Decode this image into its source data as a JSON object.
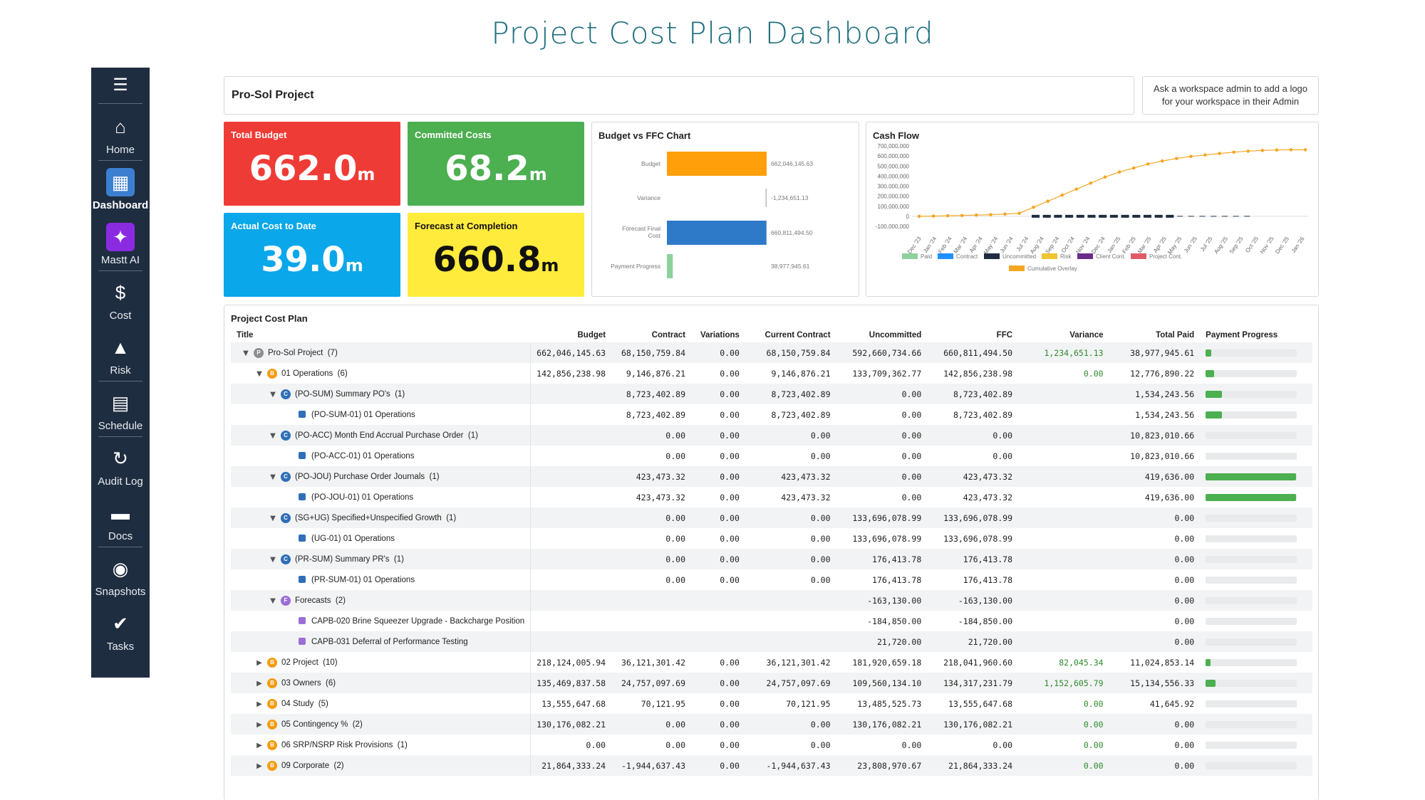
{
  "page_title": "Project Cost Plan Dashboard",
  "sidebar": {
    "items": [
      {
        "name": "home",
        "label": "Home",
        "icon": "home-icon",
        "glyph": "⌂",
        "active": false
      },
      {
        "name": "dashboard",
        "label": "Dashboard",
        "icon": "dashboard-icon",
        "glyph": "▦",
        "active": true
      },
      {
        "name": "mastt-ai",
        "label": "Mastt AI",
        "icon": "sparkle-icon",
        "glyph": "✦",
        "active": false
      },
      {
        "name": "cost",
        "label": "Cost",
        "icon": "dollar-icon",
        "glyph": "$",
        "active": false
      },
      {
        "name": "risk",
        "label": "Risk",
        "icon": "warning-icon",
        "glyph": "▲",
        "active": false
      },
      {
        "name": "schedule",
        "label": "Schedule",
        "icon": "schedule-icon",
        "glyph": "▤",
        "active": false
      },
      {
        "name": "audit-log",
        "label": "Audit Log",
        "icon": "history-icon",
        "glyph": "↻",
        "active": false
      },
      {
        "name": "docs",
        "label": "Docs",
        "icon": "folder-icon",
        "glyph": "▬",
        "active": false
      },
      {
        "name": "snapshots",
        "label": "Snapshots",
        "icon": "camera-icon",
        "glyph": "◉",
        "active": false
      },
      {
        "name": "tasks",
        "label": "Tasks",
        "icon": "check-icon",
        "glyph": "✔",
        "active": false
      }
    ]
  },
  "header": {
    "project_name": "Pro-Sol Project",
    "logo_prompt": "Ask a workspace admin to add a logo for your workspace in their Admin"
  },
  "kpis": {
    "total_budget": {
      "title": "Total Budget",
      "value": "662.0",
      "unit": "m"
    },
    "committed_costs": {
      "title": "Committed Costs",
      "value": "68.2",
      "unit": "m"
    },
    "actual_cost": {
      "title": "Actual Cost to Date",
      "value": "39.0",
      "unit": "m"
    },
    "forecast": {
      "title": "Forecast at Completion",
      "value": "660.8",
      "unit": "m"
    }
  },
  "chart_data": [
    {
      "type": "bar",
      "title": "Budget vs FFC Chart",
      "orientation": "horizontal",
      "categories": [
        "Budget",
        "Variance",
        "Forecast Final Cost",
        "Payment Progress"
      ],
      "values": [
        662046145.63,
        -1234651.13,
        660811494.5,
        38977945.61
      ],
      "value_labels": [
        "662,046,145.63",
        "-1,234,651.13",
        "660,811,494.50",
        "38,977,945.61"
      ],
      "colors": [
        "#ff9f0a",
        "#bbbbbb",
        "#2f7ac8",
        "#8fd19e"
      ]
    },
    {
      "type": "line",
      "title": "Cash Flow",
      "x": [
        "Dec '23",
        "Jan '24",
        "Feb '24",
        "Mar '24",
        "Apr '24",
        "May '24",
        "Jun '24",
        "Jul '24",
        "Aug '24",
        "Sep '24",
        "Oct '24",
        "Nov '24",
        "Dec '24",
        "Jan '25",
        "Feb '25",
        "Mar '25",
        "Apr '25",
        "May '25",
        "Jun '25",
        "Jul '25",
        "Aug '25",
        "Sep '25",
        "Oct '25",
        "Nov '25",
        "Dec '25",
        "Jan '26"
      ],
      "yticks": [
        "700,000,000",
        "600,000,000",
        "500,000,000",
        "400,000,000",
        "300,000,000",
        "200,000,000",
        "100,000,000",
        "0",
        "-100,000,000"
      ],
      "ylim": [
        -100000000,
        700000000
      ],
      "series": [
        {
          "name": "Cumulative Overlay",
          "color": "#f5a623",
          "values": [
            0,
            2000000,
            5000000,
            8000000,
            12000000,
            16000000,
            22000000,
            30000000,
            90000000,
            150000000,
            210000000,
            270000000,
            330000000,
            390000000,
            440000000,
            480000000,
            520000000,
            550000000,
            575000000,
            595000000,
            610000000,
            625000000,
            638000000,
            648000000,
            655000000,
            660000000,
            662000000,
            662000000
          ]
        },
        {
          "name": "Uncommitted",
          "color": "#1f2d40",
          "type": "bar",
          "values": [
            0,
            0,
            0,
            0,
            0,
            0,
            0,
            0,
            0,
            0,
            0,
            0,
            0,
            0,
            0,
            0,
            0,
            0,
            0,
            0,
            0,
            0,
            0,
            0,
            0,
            0,
            0,
            0
          ],
          "bar_months": [
            11,
            23
          ]
        }
      ],
      "legend": [
        {
          "name": "Paid",
          "color": "#8fd19e"
        },
        {
          "name": "Contract",
          "color": "#1e90ff"
        },
        {
          "name": "Uncommitted",
          "color": "#1f2d40"
        },
        {
          "name": "Risk",
          "color": "#f0c330"
        },
        {
          "name": "Client Cont.",
          "color": "#6a2c8a"
        },
        {
          "name": "Project Cont.",
          "color": "#e05a6a"
        },
        {
          "name": "Cumulative Overlay",
          "color": "#f5a623"
        }
      ]
    }
  ],
  "table": {
    "title": "Project Cost Plan",
    "columns": [
      "Title",
      "Budget",
      "Contract",
      "Variations",
      "Current Contract",
      "Uncommitted",
      "FFC",
      "Variance",
      "Total Paid",
      "Payment Progress"
    ],
    "rows": [
      {
        "level": 0,
        "chev": "down",
        "badge": "P",
        "badge_color": "#8e8e8e",
        "title": "Pro-Sol Project  (7)",
        "budget": "662,046,145.63",
        "contract": "68,150,759.84",
        "variations": "0.00",
        "current": "68,150,759.84",
        "uncommitted": "592,660,734.66",
        "ffc": "660,811,494.50",
        "variance": "1,234,651.13",
        "variance_green": true,
        "paid": "38,977,945.61",
        "progress": 0.06
      },
      {
        "level": 1,
        "chev": "down",
        "badge": "B",
        "badge_color": "#f39c12",
        "title": "01 Operations  (6)",
        "budget": "142,856,238.98",
        "contract": "9,146,876.21",
        "variations": "0.00",
        "current": "9,146,876.21",
        "uncommitted": "133,709,362.77",
        "ffc": "142,856,238.98",
        "variance": "0.00",
        "variance_green": true,
        "paid": "12,776,890.22",
        "progress": 0.09
      },
      {
        "level": 2,
        "chev": "down",
        "badge": "C",
        "badge_color": "#2f6fb8",
        "title": "(PO-SUM) Summary PO's  (1)",
        "budget": "",
        "contract": "8,723,402.89",
        "variations": "0.00",
        "current": "8,723,402.89",
        "uncommitted": "0.00",
        "ffc": "8,723,402.89",
        "variance": "",
        "variance_green": false,
        "paid": "1,534,243.56",
        "progress": 0.18
      },
      {
        "level": 3,
        "chev": "",
        "square": "#2f6fb8",
        "title": "(PO-SUM-01) 01 Operations",
        "budget": "",
        "contract": "8,723,402.89",
        "variations": "0.00",
        "current": "8,723,402.89",
        "uncommitted": "0.00",
        "ffc": "8,723,402.89",
        "variance": "",
        "variance_green": false,
        "paid": "1,534,243.56",
        "progress": 0.18
      },
      {
        "level": 2,
        "chev": "down",
        "badge": "C",
        "badge_color": "#2f6fb8",
        "title": "(PO-ACC) Month End Accrual Purchase Order  (1)",
        "budget": "",
        "contract": "0.00",
        "variations": "0.00",
        "current": "0.00",
        "uncommitted": "0.00",
        "ffc": "0.00",
        "variance": "",
        "variance_green": false,
        "paid": "10,823,010.66",
        "progress": 0.0
      },
      {
        "level": 3,
        "chev": "",
        "square": "#2f6fb8",
        "title": "(PO-ACC-01) 01 Operations",
        "budget": "",
        "contract": "0.00",
        "variations": "0.00",
        "current": "0.00",
        "uncommitted": "0.00",
        "ffc": "0.00",
        "variance": "",
        "variance_green": false,
        "paid": "10,823,010.66",
        "progress": 0.0
      },
      {
        "level": 2,
        "chev": "down",
        "badge": "C",
        "badge_color": "#2f6fb8",
        "title": "(PO-JOU) Purchase Order Journals  (1)",
        "budget": "",
        "contract": "423,473.32",
        "variations": "0.00",
        "current": "423,473.32",
        "uncommitted": "0.00",
        "ffc": "423,473.32",
        "variance": "",
        "variance_green": false,
        "paid": "419,636.00",
        "progress": 0.99
      },
      {
        "level": 3,
        "chev": "",
        "square": "#2f6fb8",
        "title": "(PO-JOU-01) 01 Operations",
        "budget": "",
        "contract": "423,473.32",
        "variations": "0.00",
        "current": "423,473.32",
        "uncommitted": "0.00",
        "ffc": "423,473.32",
        "variance": "",
        "variance_green": false,
        "paid": "419,636.00",
        "progress": 0.99
      },
      {
        "level": 2,
        "chev": "down",
        "badge": "C",
        "badge_color": "#2f6fb8",
        "title": "(SG+UG) Specified+Unspecified Growth  (1)",
        "budget": "",
        "contract": "0.00",
        "variations": "0.00",
        "current": "0.00",
        "uncommitted": "133,696,078.99",
        "ffc": "133,696,078.99",
        "variance": "",
        "variance_green": false,
        "paid": "0.00",
        "progress": 0.0
      },
      {
        "level": 3,
        "chev": "",
        "square": "#2f6fb8",
        "title": "(UG-01) 01 Operations",
        "budget": "",
        "contract": "0.00",
        "variations": "0.00",
        "current": "0.00",
        "uncommitted": "133,696,078.99",
        "ffc": "133,696,078.99",
        "variance": "",
        "variance_green": false,
        "paid": "0.00",
        "progress": 0.0
      },
      {
        "level": 2,
        "chev": "down",
        "badge": "C",
        "badge_color": "#2f6fb8",
        "title": "(PR-SUM) Summary PR's  (1)",
        "budget": "",
        "contract": "0.00",
        "variations": "0.00",
        "current": "0.00",
        "uncommitted": "176,413.78",
        "ffc": "176,413.78",
        "variance": "",
        "variance_green": false,
        "paid": "0.00",
        "progress": 0.0
      },
      {
        "level": 3,
        "chev": "",
        "square": "#2f6fb8",
        "title": "(PR-SUM-01) 01 Operations",
        "budget": "",
        "contract": "0.00",
        "variations": "0.00",
        "current": "0.00",
        "uncommitted": "176,413.78",
        "ffc": "176,413.78",
        "variance": "",
        "variance_green": false,
        "paid": "0.00",
        "progress": 0.0
      },
      {
        "level": 2,
        "chev": "down",
        "badge": "F",
        "badge_color": "#9b6fd6",
        "title": "Forecasts  (2)",
        "budget": "",
        "contract": "",
        "variations": "",
        "current": "",
        "uncommitted": "-163,130.00",
        "ffc": "-163,130.00",
        "variance": "",
        "variance_green": false,
        "paid": "0.00",
        "progress": 0.0
      },
      {
        "level": 3,
        "chev": "",
        "square": "#9b6fd6",
        "title": "CAPB-020 Brine Squeezer Upgrade - Backcharge Position",
        "budget": "",
        "contract": "",
        "variations": "",
        "current": "",
        "uncommitted": "-184,850.00",
        "ffc": "-184,850.00",
        "variance": "",
        "variance_green": false,
        "paid": "0.00",
        "progress": 0.0
      },
      {
        "level": 3,
        "chev": "",
        "square": "#9b6fd6",
        "title": "CAPB-031 Deferral of Performance Testing",
        "budget": "",
        "contract": "",
        "variations": "",
        "current": "",
        "uncommitted": "21,720.00",
        "ffc": "21,720.00",
        "variance": "",
        "variance_green": false,
        "paid": "0.00",
        "progress": 0.0
      },
      {
        "level": 1,
        "chev": "right",
        "badge": "B",
        "badge_color": "#f39c12",
        "title": "02 Project  (10)",
        "budget": "218,124,005.94",
        "contract": "36,121,301.42",
        "variations": "0.00",
        "current": "36,121,301.42",
        "uncommitted": "181,920,659.18",
        "ffc": "218,041,960.60",
        "variance": "82,045.34",
        "variance_green": true,
        "paid": "11,024,853.14",
        "progress": 0.05
      },
      {
        "level": 1,
        "chev": "right",
        "badge": "B",
        "badge_color": "#f39c12",
        "title": "03 Owners  (6)",
        "budget": "135,469,837.58",
        "contract": "24,757,097.69",
        "variations": "0.00",
        "current": "24,757,097.69",
        "uncommitted": "109,560,134.10",
        "ffc": "134,317,231.79",
        "variance": "1,152,605.79",
        "variance_green": true,
        "paid": "15,134,556.33",
        "progress": 0.11
      },
      {
        "level": 1,
        "chev": "right",
        "badge": "B",
        "badge_color": "#f39c12",
        "title": "04 Study  (5)",
        "budget": "13,555,647.68",
        "contract": "70,121.95",
        "variations": "0.00",
        "current": "70,121.95",
        "uncommitted": "13,485,525.73",
        "ffc": "13,555,647.68",
        "variance": "0.00",
        "variance_green": true,
        "paid": "41,645.92",
        "progress": 0.0
      },
      {
        "level": 1,
        "chev": "right",
        "badge": "B",
        "badge_color": "#f39c12",
        "title": "05 Contingency %  (2)",
        "budget": "130,176,082.21",
        "contract": "0.00",
        "variations": "0.00",
        "current": "0.00",
        "uncommitted": "130,176,082.21",
        "ffc": "130,176,082.21",
        "variance": "0.00",
        "variance_green": true,
        "paid": "0.00",
        "progress": 0.0
      },
      {
        "level": 1,
        "chev": "right",
        "badge": "B",
        "badge_color": "#f39c12",
        "title": "06 SRP/NSRP Risk Provisions  (1)",
        "budget": "0.00",
        "contract": "0.00",
        "variations": "0.00",
        "current": "0.00",
        "uncommitted": "0.00",
        "ffc": "0.00",
        "variance": "0.00",
        "variance_green": true,
        "paid": "0.00",
        "progress": 0.0
      },
      {
        "level": 1,
        "chev": "right",
        "badge": "B",
        "badge_color": "#f39c12",
        "title": "09 Corporate  (2)",
        "budget": "21,864,333.24",
        "contract": "-1,944,637.43",
        "variations": "0.00",
        "current": "-1,944,637.43",
        "uncommitted": "23,808,970.67",
        "ffc": "21,864,333.24",
        "variance": "0.00",
        "variance_green": true,
        "paid": "0.00",
        "progress": 0.0
      }
    ]
  }
}
